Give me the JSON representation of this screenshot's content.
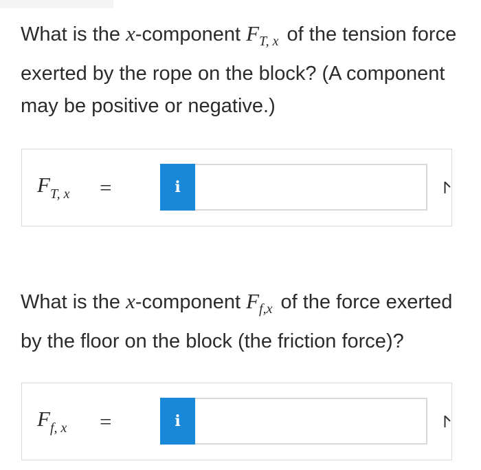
{
  "question1": {
    "text_before": "What is the ",
    "var_x": "x",
    "text_mid": "-component ",
    "symbol": "F",
    "subscript": "T, x",
    "text_after": "of the tension force exerted by the rope on the block? (A component may be positive or negative.)"
  },
  "answer1": {
    "label_symbol": "F",
    "label_subscript": "T, x",
    "equals": "=",
    "info_label": "i",
    "value": ""
  },
  "question2": {
    "text_before": "What is the ",
    "var_x": "x",
    "text_mid": "-component ",
    "symbol": "F",
    "subscript": "f,x",
    "text_after": "of the force exerted by the floor on the block (the friction force)?"
  },
  "answer2": {
    "label_symbol": "F",
    "label_subscript": "f, x",
    "equals": "=",
    "info_label": "i",
    "value": ""
  },
  "colors": {
    "info_button": "#1a88d8",
    "border": "#d9d9d9",
    "text": "#2b2b2b"
  },
  "icons": [
    "info-icon",
    "flag-icon"
  ]
}
